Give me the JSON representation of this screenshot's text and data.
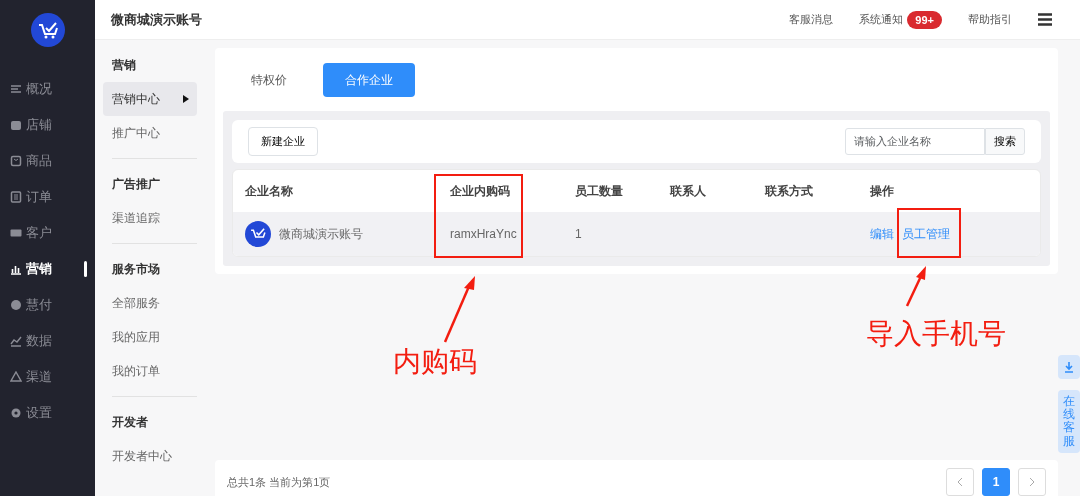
{
  "nav": [
    {
      "label": "概况",
      "selected": false
    },
    {
      "label": "店铺",
      "selected": false
    },
    {
      "label": "商品",
      "selected": false
    },
    {
      "label": "订单",
      "selected": false
    },
    {
      "label": "客户",
      "selected": false
    },
    {
      "label": "营销",
      "selected": true
    },
    {
      "label": "慧付",
      "selected": false
    },
    {
      "label": "数据",
      "selected": false
    },
    {
      "label": "渠道",
      "selected": false
    },
    {
      "label": "设置",
      "selected": false
    }
  ],
  "header": {
    "title": "微商城演示账号",
    "links": [
      {
        "label": "客服消息"
      },
      {
        "label": "系统通知",
        "badge": "99+"
      },
      {
        "label": "帮助指引"
      }
    ]
  },
  "subnav": [
    {
      "title": "营销",
      "items": [
        {
          "label": "营销中心",
          "selected": true
        },
        {
          "label": "推广中心",
          "selected": false
        }
      ]
    },
    {
      "title": "广告推广",
      "items": [
        {
          "label": "渠道追踪",
          "selected": false
        }
      ]
    },
    {
      "title": "服务市场",
      "items": [
        {
          "label": "全部服务",
          "selected": false
        },
        {
          "label": "我的应用",
          "selected": false
        },
        {
          "label": "我的订单",
          "selected": false
        }
      ]
    },
    {
      "title": "开发者",
      "items": [
        {
          "label": "开发者中心",
          "selected": false
        }
      ]
    }
  ],
  "tabs": [
    {
      "label": "特权价",
      "selected": false
    },
    {
      "label": "合作企业",
      "selected": true
    }
  ],
  "new_button": "新建企业",
  "search": {
    "placeholder": "请输入企业名称",
    "button": "搜索"
  },
  "table": {
    "columns": [
      "企业名称",
      "企业内购码",
      "员工数量",
      "联系人",
      "联系方式",
      "操作"
    ],
    "rows": [
      {
        "name": "微商城演示账号",
        "code": "ramxHraYnc",
        "count": "1",
        "actions": [
          "编辑",
          "员工管理"
        ]
      }
    ]
  },
  "pagination": {
    "summary": "总共1条 当前为第1页",
    "pages": [
      {
        "label": "1",
        "selected": true
      }
    ]
  },
  "float": {
    "chat": "在线客服"
  },
  "annotations": [
    {
      "text": "内购码"
    },
    {
      "text": "导入手机号"
    }
  ]
}
